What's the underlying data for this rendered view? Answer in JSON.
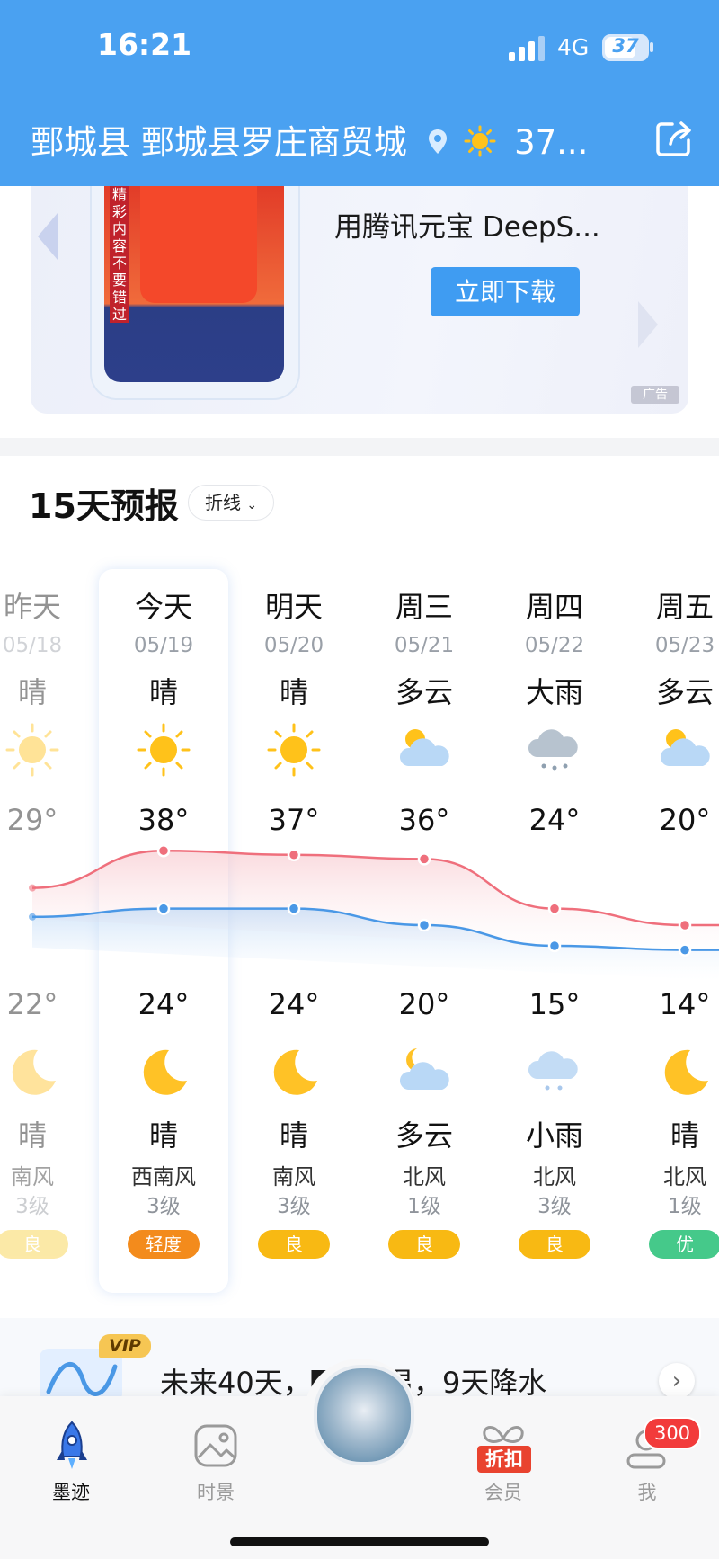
{
  "status_bar": {
    "time": "16:21",
    "network": "4G",
    "battery": "37"
  },
  "header": {
    "location": "鄄城县 鄄城县罗庄商贸城",
    "temperature": "37..."
  },
  "ad": {
    "strip_text": "精彩内容不要错过",
    "title": "用腾讯元宝 DeepS...",
    "button": "立即下载",
    "tag": "广告"
  },
  "forecast": {
    "title": "15天预报",
    "mode": "折线",
    "days": [
      {
        "name": "昨天",
        "date": "05/18",
        "day_cond": "晴",
        "day_icon": "sun-icon",
        "high": "29°",
        "low": "22°",
        "night_icon": "moon-icon",
        "night_cond": "晴",
        "wind": "南风",
        "level": "3级",
        "aqi": "良",
        "aqi_color": "#f8cf3e"
      },
      {
        "name": "今天",
        "date": "05/19",
        "day_cond": "晴",
        "day_icon": "sun-icon",
        "high": "38°",
        "low": "24°",
        "night_icon": "moon-icon",
        "night_cond": "晴",
        "wind": "西南风",
        "level": "3级",
        "aqi": "轻度",
        "aqi_color": "#f38b1c"
      },
      {
        "name": "明天",
        "date": "05/20",
        "day_cond": "晴",
        "day_icon": "sun-icon",
        "high": "37°",
        "low": "24°",
        "night_icon": "moon-icon",
        "night_cond": "晴",
        "wind": "南风",
        "level": "3级",
        "aqi": "良",
        "aqi_color": "#f8b913"
      },
      {
        "name": "周三",
        "date": "05/21",
        "day_cond": "多云",
        "day_icon": "partly-cloudy-icon",
        "high": "36°",
        "low": "20°",
        "night_icon": "cloudy-night-icon",
        "night_cond": "多云",
        "wind": "北风",
        "level": "1级",
        "aqi": "良",
        "aqi_color": "#f8b913"
      },
      {
        "name": "周四",
        "date": "05/22",
        "day_cond": "大雨",
        "day_icon": "heavy-rain-icon",
        "high": "24°",
        "low": "15°",
        "night_icon": "light-rain-icon",
        "night_cond": "小雨",
        "wind": "北风",
        "level": "3级",
        "aqi": "良",
        "aqi_color": "#f8b913"
      },
      {
        "name": "周五",
        "date": "05/23",
        "day_cond": "多云",
        "day_icon": "partly-cloudy-icon",
        "high": "20°",
        "low": "14°",
        "night_icon": "moon-icon",
        "night_cond": "晴",
        "wind": "北风",
        "level": "1级",
        "aqi": "优",
        "aqi_color": "#45c98a"
      }
    ]
  },
  "chart_data": {
    "type": "line",
    "categories": [
      "05/18",
      "05/19",
      "05/20",
      "05/21",
      "05/22",
      "05/23"
    ],
    "series": [
      {
        "values": [
          29,
          38,
          37,
          36,
          24,
          20
        ],
        "color": "#ef6f7c"
      },
      {
        "values": [
          22,
          24,
          24,
          20,
          15,
          14
        ],
        "color": "#4a98e6"
      }
    ]
  },
  "vip": {
    "badge": "VIP",
    "text": "未来40天，▇▇高温，9天降水"
  },
  "tabbar": {
    "tabs": [
      {
        "label": "墨迹",
        "icon": "rocket-icon"
      },
      {
        "label": "时景",
        "icon": "photo-icon"
      },
      {
        "label": "会员",
        "icon": "gift-icon"
      },
      {
        "label": "我",
        "icon": "user-icon"
      }
    ],
    "discount": "折扣",
    "me_badge": "300"
  }
}
